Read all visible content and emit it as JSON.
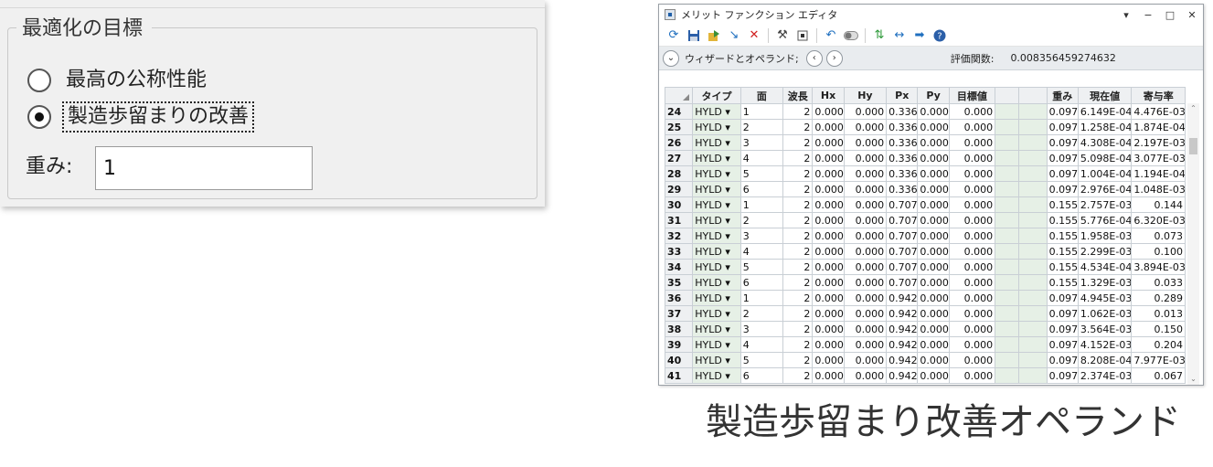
{
  "goal_group": {
    "title": "最適化の目標",
    "options": [
      {
        "label": "最高の公称性能",
        "checked": false
      },
      {
        "label": "製造歩留まりの改善",
        "checked": true
      }
    ],
    "weight_label": "重み:",
    "weight_value": "1"
  },
  "editor": {
    "title": "メリット ファンクション エディタ",
    "window_controls": {
      "menu": "▾",
      "minimize": "−",
      "maximize": "□",
      "close": "✕"
    },
    "toolbar_icons": [
      "refresh-icon",
      "save-icon",
      "load-icon",
      "insert-icon",
      "delete-icon",
      "tools-icon",
      "stop-icon",
      "undo-icon",
      "toggle-icon",
      "swap-icon",
      "collapse-icon",
      "next-icon",
      "help-icon"
    ],
    "wizard_label": "ウィザードとオペランド;",
    "merit_label": "評価関数:",
    "merit_value": "0.008356459274632",
    "columns": [
      "タイプ",
      "面",
      "波長",
      "Hx",
      "Hy",
      "Px",
      "Py",
      "目標値",
      "",
      "",
      "重み",
      "現在値",
      "寄与率"
    ],
    "rows": [
      {
        "n": "24",
        "type": "HYLD ▾",
        "surf": "1",
        "wave": "2",
        "hx": "0.000",
        "hy": "0.000",
        "px": "0.336",
        "py": "0.000",
        "target": "0.000",
        "weight": "0.097",
        "value": "6.149E-04",
        "contrib": "4.476E-03"
      },
      {
        "n": "25",
        "type": "HYLD ▾",
        "surf": "2",
        "wave": "2",
        "hx": "0.000",
        "hy": "0.000",
        "px": "0.336",
        "py": "0.000",
        "target": "0.000",
        "weight": "0.097",
        "value": "1.258E-04",
        "contrib": "1.874E-04"
      },
      {
        "n": "26",
        "type": "HYLD ▾",
        "surf": "3",
        "wave": "2",
        "hx": "0.000",
        "hy": "0.000",
        "px": "0.336",
        "py": "0.000",
        "target": "0.000",
        "weight": "0.097",
        "value": "4.308E-04",
        "contrib": "2.197E-03"
      },
      {
        "n": "27",
        "type": "HYLD ▾",
        "surf": "4",
        "wave": "2",
        "hx": "0.000",
        "hy": "0.000",
        "px": "0.336",
        "py": "0.000",
        "target": "0.000",
        "weight": "0.097",
        "value": "5.098E-04",
        "contrib": "3.077E-03"
      },
      {
        "n": "28",
        "type": "HYLD ▾",
        "surf": "5",
        "wave": "2",
        "hx": "0.000",
        "hy": "0.000",
        "px": "0.336",
        "py": "0.000",
        "target": "0.000",
        "weight": "0.097",
        "value": "1.004E-04",
        "contrib": "1.194E-04"
      },
      {
        "n": "29",
        "type": "HYLD ▾",
        "surf": "6",
        "wave": "2",
        "hx": "0.000",
        "hy": "0.000",
        "px": "0.336",
        "py": "0.000",
        "target": "0.000",
        "weight": "0.097",
        "value": "2.976E-04",
        "contrib": "1.048E-03"
      },
      {
        "n": "30",
        "type": "HYLD ▾",
        "surf": "1",
        "wave": "2",
        "hx": "0.000",
        "hy": "0.000",
        "px": "0.707",
        "py": "0.000",
        "target": "0.000",
        "weight": "0.155",
        "value": "2.757E-03",
        "contrib": "0.144"
      },
      {
        "n": "31",
        "type": "HYLD ▾",
        "surf": "2",
        "wave": "2",
        "hx": "0.000",
        "hy": "0.000",
        "px": "0.707",
        "py": "0.000",
        "target": "0.000",
        "weight": "0.155",
        "value": "5.776E-04",
        "contrib": "6.320E-03"
      },
      {
        "n": "32",
        "type": "HYLD ▾",
        "surf": "3",
        "wave": "2",
        "hx": "0.000",
        "hy": "0.000",
        "px": "0.707",
        "py": "0.000",
        "target": "0.000",
        "weight": "0.155",
        "value": "1.958E-03",
        "contrib": "0.073"
      },
      {
        "n": "33",
        "type": "HYLD ▾",
        "surf": "4",
        "wave": "2",
        "hx": "0.000",
        "hy": "0.000",
        "px": "0.707",
        "py": "0.000",
        "target": "0.000",
        "weight": "0.155",
        "value": "2.299E-03",
        "contrib": "0.100"
      },
      {
        "n": "34",
        "type": "HYLD ▾",
        "surf": "5",
        "wave": "2",
        "hx": "0.000",
        "hy": "0.000",
        "px": "0.707",
        "py": "0.000",
        "target": "0.000",
        "weight": "0.155",
        "value": "4.534E-04",
        "contrib": "3.894E-03"
      },
      {
        "n": "35",
        "type": "HYLD ▾",
        "surf": "6",
        "wave": "2",
        "hx": "0.000",
        "hy": "0.000",
        "px": "0.707",
        "py": "0.000",
        "target": "0.000",
        "weight": "0.155",
        "value": "1.329E-03",
        "contrib": "0.033"
      },
      {
        "n": "36",
        "type": "HYLD ▾",
        "surf": "1",
        "wave": "2",
        "hx": "0.000",
        "hy": "0.000",
        "px": "0.942",
        "py": "0.000",
        "target": "0.000",
        "weight": "0.097",
        "value": "4.945E-03",
        "contrib": "0.289"
      },
      {
        "n": "37",
        "type": "HYLD ▾",
        "surf": "2",
        "wave": "2",
        "hx": "0.000",
        "hy": "0.000",
        "px": "0.942",
        "py": "0.000",
        "target": "0.000",
        "weight": "0.097",
        "value": "1.062E-03",
        "contrib": "0.013"
      },
      {
        "n": "38",
        "type": "HYLD ▾",
        "surf": "3",
        "wave": "2",
        "hx": "0.000",
        "hy": "0.000",
        "px": "0.942",
        "py": "0.000",
        "target": "0.000",
        "weight": "0.097",
        "value": "3.564E-03",
        "contrib": "0.150"
      },
      {
        "n": "39",
        "type": "HYLD ▾",
        "surf": "4",
        "wave": "2",
        "hx": "0.000",
        "hy": "0.000",
        "px": "0.942",
        "py": "0.000",
        "target": "0.000",
        "weight": "0.097",
        "value": "4.152E-03",
        "contrib": "0.204"
      },
      {
        "n": "40",
        "type": "HYLD ▾",
        "surf": "5",
        "wave": "2",
        "hx": "0.000",
        "hy": "0.000",
        "px": "0.942",
        "py": "0.000",
        "target": "0.000",
        "weight": "0.097",
        "value": "8.208E-04",
        "contrib": "7.977E-03"
      },
      {
        "n": "41",
        "type": "HYLD ▾",
        "surf": "6",
        "wave": "2",
        "hx": "0.000",
        "hy": "0.000",
        "px": "0.942",
        "py": "0.000",
        "target": "0.000",
        "weight": "0.097",
        "value": "2.374E-03",
        "contrib": "0.067"
      }
    ]
  },
  "caption": "製造歩留まり改善オペランド",
  "colors": {
    "panel_bg": "#f0f0f0",
    "grid_green": "#e6f0e6",
    "header_bg": "#eef0f2",
    "toolbar_blue": "#1f6fbf"
  }
}
